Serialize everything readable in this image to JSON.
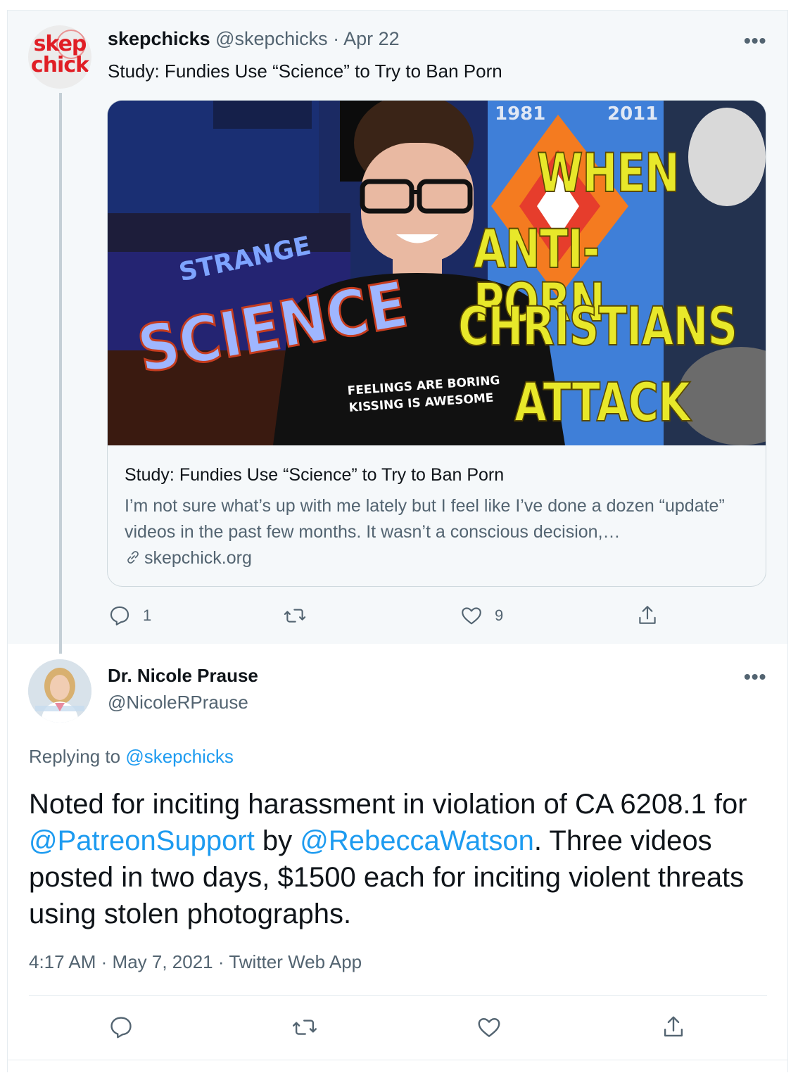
{
  "parent_tweet": {
    "display_name": "skepchicks",
    "handle": "@skepchicks",
    "separator": "·",
    "date": "Apr 22",
    "text": "Study: Fundies Use “Science” to Try to Ban Porn",
    "avatar_logo_top": "skep",
    "avatar_logo_bottom": "chick",
    "more_label": "•••",
    "card": {
      "thumbnail": {
        "headline_lines": [
          "WHEN",
          "ANTI-PORN",
          "CHRISTIANS",
          "ATTACK"
        ],
        "shirt_lines": [
          "FEELINGS ARE BORING",
          "KISSING IS AWESOME"
        ],
        "poster_years": [
          "1981",
          "2011"
        ],
        "sign_top": "STRANGE",
        "sign_bottom": "SCIENCE",
        "colors": {
          "headline": "#e8e82a",
          "backdrop": "#1b2a63"
        }
      },
      "title": "Study: Fundies Use “Science” to Try to Ban Porn",
      "description": "I’m not sure what’s up with me lately but I feel like I’ve done a dozen “update” videos in the past few months. It wasn’t a conscious decision,…",
      "domain": "skepchick.org",
      "link_icon": "link-icon"
    },
    "actions": {
      "reply_count": "1",
      "retweet_count": "",
      "like_count": "9"
    }
  },
  "reply_tweet": {
    "display_name": "Dr. Nicole Prause",
    "handle": "@NicoleRPrause",
    "more_label": "•••",
    "replying_prefix": "Replying to",
    "replying_handle": "@skepchicks",
    "text_part1": "Noted for inciting harassment in violation of CA 6208.1 for ",
    "mention1": "@PatreonSupport",
    "text_part2": " by ",
    "mention2": "@RebeccaWatson",
    "text_part3": ". Three videos posted in two days, $1500 each for inciting violent threats using stolen photographs.",
    "time": "4:17 AM",
    "date": "May 7, 2021",
    "source": "Twitter Web App",
    "separator": "·"
  },
  "colors": {
    "link": "#1d9bf0",
    "muted": "#536471",
    "parent_bg": "#f5f8fa",
    "thread_line": "#c4cfd6"
  }
}
